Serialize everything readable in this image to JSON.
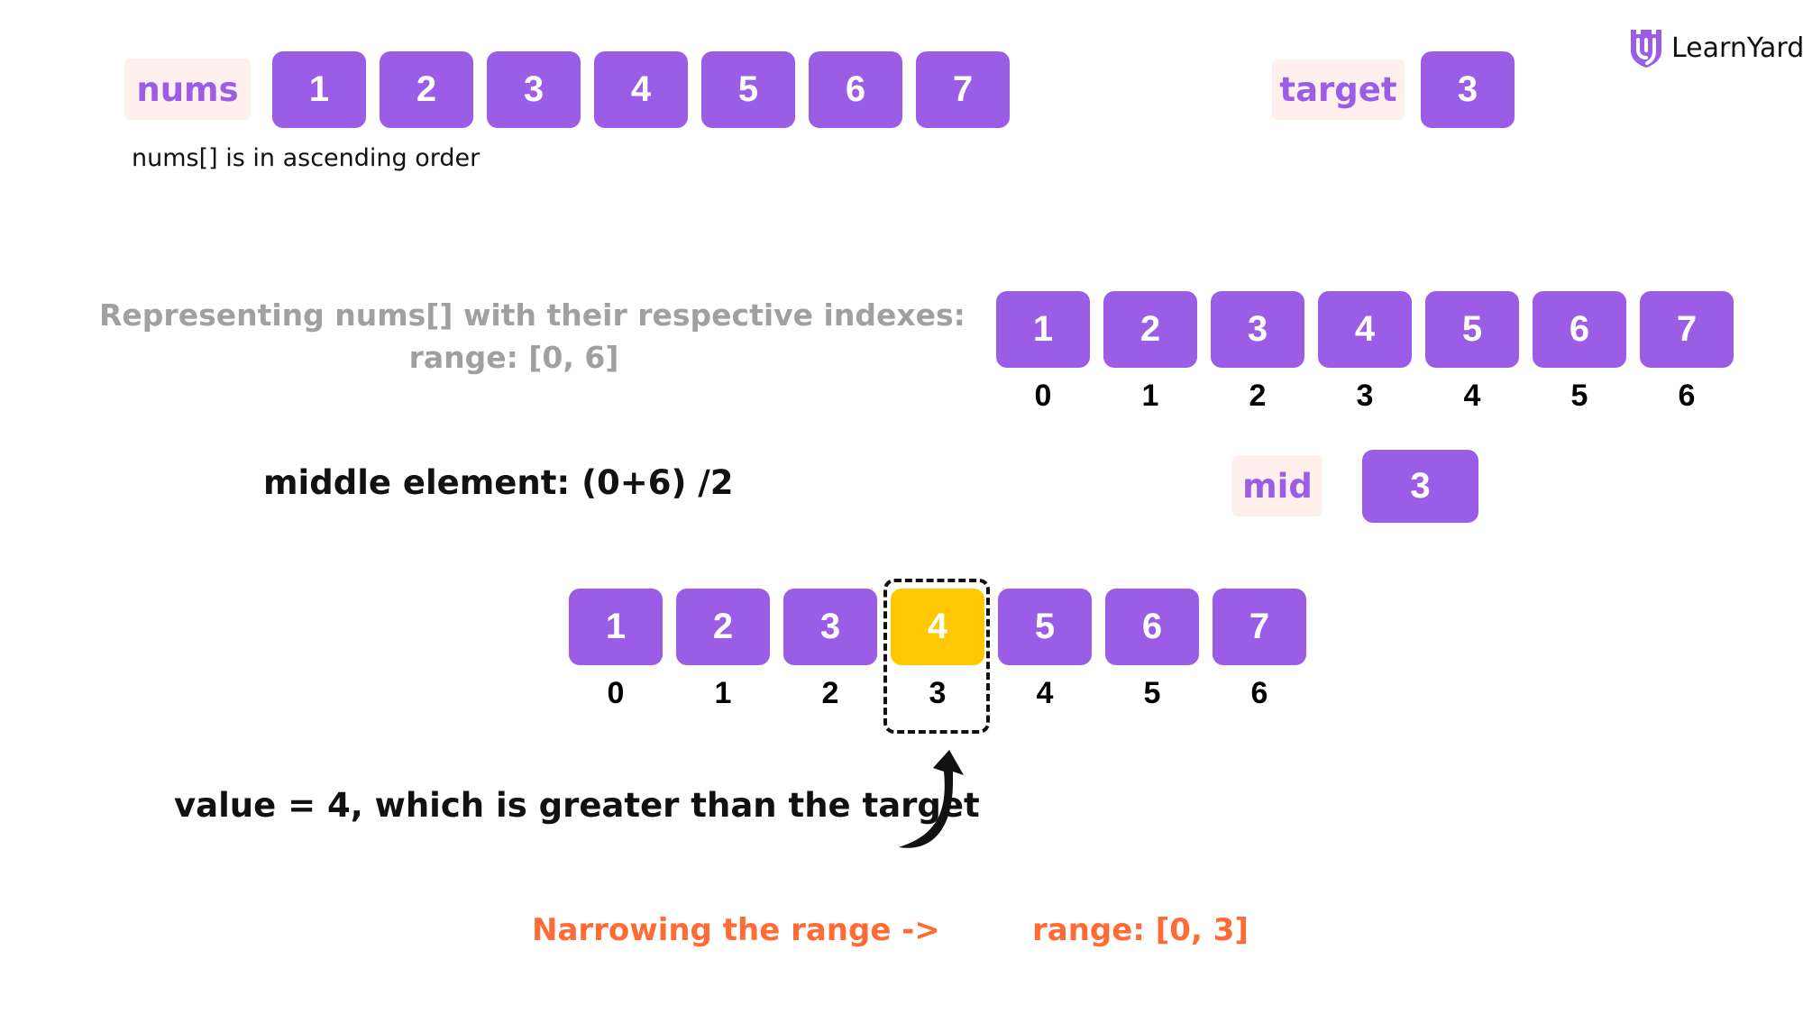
{
  "brand": {
    "name": "LearnYard",
    "logo_icon": "shield-y-icon",
    "color": "#9b5de5"
  },
  "colors": {
    "cell": "#9b5de5",
    "highlight": "#ffc800",
    "tag_bg": "#fff0ee",
    "accent_orange": "#ff6b35",
    "muted": "#a0a0a0"
  },
  "top": {
    "nums_label": "nums",
    "nums": [
      "1",
      "2",
      "3",
      "4",
      "5",
      "6",
      "7"
    ],
    "note": "nums[] is in ascending order",
    "target_label": "target",
    "target_value": "3"
  },
  "indexed": {
    "caption_line1": "Representing nums[] with their respective indexes:",
    "caption_line2": "range: [0, 6]",
    "values": [
      "1",
      "2",
      "3",
      "4",
      "5",
      "6",
      "7"
    ],
    "indexes": [
      "0",
      "1",
      "2",
      "3",
      "4",
      "5",
      "6"
    ]
  },
  "middle": {
    "formula": "middle element: (0+6) /2",
    "mid_label": "mid",
    "mid_value": "3"
  },
  "highlighted": {
    "values": [
      "1",
      "2",
      "3",
      "4",
      "5",
      "6",
      "7"
    ],
    "indexes": [
      "0",
      "1",
      "2",
      "3",
      "4",
      "5",
      "6"
    ],
    "highlight_index": 3
  },
  "comparison": {
    "text": "value = 4, which is greater than the target"
  },
  "narrowing": {
    "label": "Narrowing the range ->",
    "new_range": "range: [0, 3]"
  }
}
